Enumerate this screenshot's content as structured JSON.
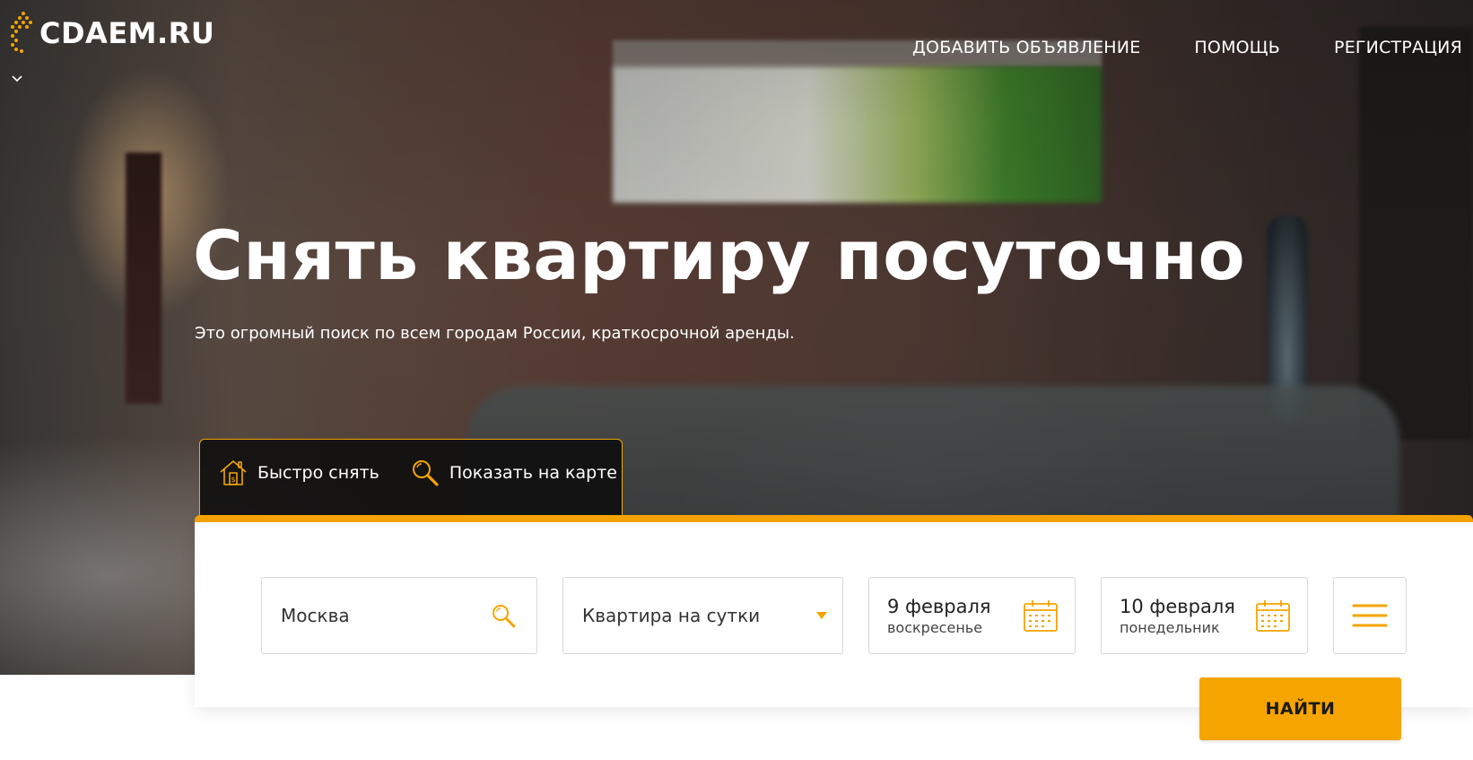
{
  "brand": {
    "logo_text": "CDAEM.RU",
    "accent": "#f5a400"
  },
  "nav": {
    "add_listing": "ДОБАВИТЬ ОБЪЯВЛЕНИЕ",
    "help": "ПОМОЩЬ",
    "register": "РЕГИСТРАЦИЯ"
  },
  "hero": {
    "title": "Снять квартиру посуточно",
    "subtitle": "Это огромный поиск по всем городам России, краткосрочной аренды."
  },
  "tabs": [
    {
      "label": "Быстро снять",
      "icon": "house-icon"
    },
    {
      "label": "Показать на карте",
      "icon": "magnifier-icon"
    }
  ],
  "search": {
    "city_value": "Москва",
    "type_value": "Квартира на сутки",
    "date_from": {
      "day": "9 февраля",
      "weekday": "воскресенье"
    },
    "date_to": {
      "day": "10 февраля",
      "weekday": "понедельник"
    },
    "submit_label": "НАЙТИ"
  }
}
